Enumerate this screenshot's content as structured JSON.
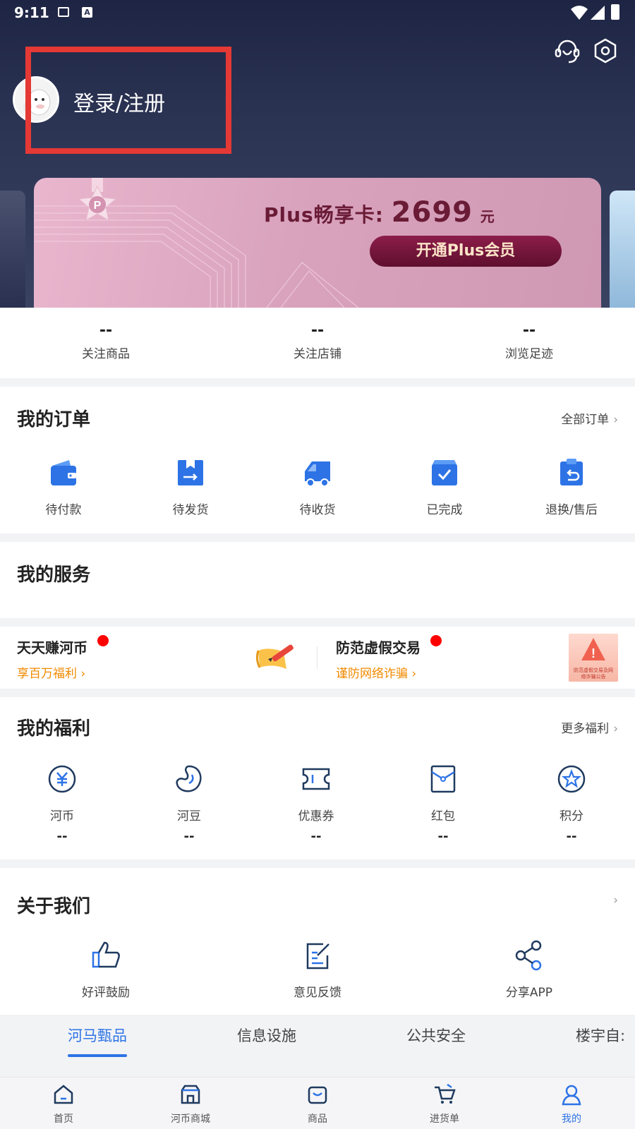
{
  "status_bar": {
    "time": "9:11"
  },
  "header": {
    "login_label": "登录/注册",
    "icons": [
      "customer-service-icon",
      "settings-icon"
    ]
  },
  "plus_card": {
    "title": "Plus畅享卡:",
    "price": "2699",
    "unit": "元",
    "button": "开通Plus会员"
  },
  "stats": [
    {
      "value": "--",
      "label": "关注商品"
    },
    {
      "value": "--",
      "label": "关注店铺"
    },
    {
      "value": "--",
      "label": "浏览足迹"
    }
  ],
  "orders": {
    "title": "我的订单",
    "link": "全部订单",
    "items": [
      {
        "label": "待付款",
        "icon": "wallet-icon"
      },
      {
        "label": "待发货",
        "icon": "package-out-icon"
      },
      {
        "label": "待收货",
        "icon": "truck-icon"
      },
      {
        "label": "已完成",
        "icon": "check-box-icon"
      },
      {
        "label": "退换/售后",
        "icon": "return-clipboard-icon"
      }
    ]
  },
  "services": {
    "title": "我的服务"
  },
  "promos": [
    {
      "title": "天天赚河币",
      "subtitle": "享百万福利",
      "icon": "pencil-scroll-icon"
    },
    {
      "title": "防范虚假交易",
      "subtitle": "谨防网络诈骗",
      "icon": "warning-notice-icon",
      "image_text": "防范虚假交易及网络诈骗公告"
    }
  ],
  "benefits": {
    "title": "我的福利",
    "link": "更多福利",
    "items": [
      {
        "label": "河币",
        "value": "--",
        "icon": "coin-yuan-icon"
      },
      {
        "label": "河豆",
        "value": "--",
        "icon": "bean-icon"
      },
      {
        "label": "优惠券",
        "value": "--",
        "icon": "coupon-icon"
      },
      {
        "label": "红包",
        "value": "--",
        "icon": "red-packet-icon"
      },
      {
        "label": "积分",
        "value": "--",
        "icon": "star-points-icon"
      }
    ]
  },
  "about": {
    "title": "关于我们",
    "items": [
      {
        "label": "好评鼓励",
        "icon": "thumbs-up-icon"
      },
      {
        "label": "意见反馈",
        "icon": "feedback-edit-icon"
      },
      {
        "label": "分享APP",
        "icon": "share-icon"
      }
    ]
  },
  "tabs": [
    "河马甄品",
    "信息设施",
    "公共安全",
    "楼宇自:"
  ],
  "bottom_nav": [
    {
      "label": "首页",
      "icon": "home-icon"
    },
    {
      "label": "河币商城",
      "icon": "store-icon"
    },
    {
      "label": "商品",
      "icon": "bag-icon"
    },
    {
      "label": "进货单",
      "icon": "cart-icon"
    },
    {
      "label": "我的",
      "icon": "user-icon",
      "active": true
    }
  ],
  "colors": {
    "accent": "#2d73e6",
    "header_bg": "#2c3454",
    "promo_orange": "#f08a00",
    "highlight_red": "#e53935"
  }
}
